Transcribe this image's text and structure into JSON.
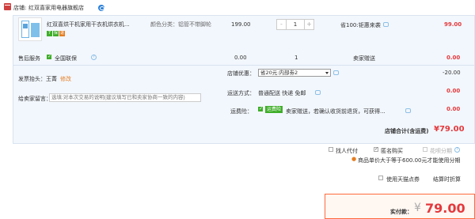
{
  "store": {
    "label": "店铺:",
    "name": "红双喜家用电器旗舰店"
  },
  "item": {
    "title": "红双喜烘干机家用干衣机烘衣机...",
    "spec": "颜色分类：铝管不带脚轮",
    "price": "199.00",
    "quantity": "1",
    "promo": "省100:钜惠来袭",
    "subtotal": "99.00",
    "badges": [
      "7",
      "保",
      "退"
    ],
    "badge_colors": [
      "#3fae29",
      "#3fae29",
      "#e67e22"
    ]
  },
  "service": {
    "label": "售后服务",
    "name": "全国联保",
    "price": "0.00",
    "quantity": "1",
    "freight_label": "卖家赠送",
    "subtotal": "0.00"
  },
  "invoice": {
    "label": "发票抬头：",
    "name": "王菁",
    "edit": "修改"
  },
  "store_coupon": {
    "label": "店铺优惠：",
    "selected": "省20元:内部劵2",
    "amount": "-20.00"
  },
  "message": {
    "label": "给卖家留言：",
    "placeholder": "选填:对本次交易的说明(建议填写已和卖家协商一致的内容)"
  },
  "delivery": {
    "label": "运送方式：",
    "value": "普通配送 快递 免邮",
    "amount": "0.00"
  },
  "insurance": {
    "label": "运费险：",
    "tag": "运费险",
    "text": "卖家赠送，若确认收货前退货，可获得...",
    "amount": "0.00"
  },
  "store_total": {
    "label": "店铺合计(含运费)",
    "amount": "¥79.00"
  },
  "options": {
    "proxy_pay": "找人代付",
    "anonymous": "匿名购买",
    "huabei": "花呗分期",
    "huabei_note": "商品单价大于等于600.00元才能使用分期",
    "tmall_points": "使用天猫点券",
    "settle_time": "结算时折算"
  },
  "payment": {
    "label": "实付款：",
    "currency": "¥",
    "amount": "79.00"
  },
  "colors": {
    "accent_red": "#e4393c",
    "box_bg": "#f2f7fd",
    "box_border": "#d9e3f0",
    "green": "#3fae29",
    "link_blue": "#2a7fd8"
  }
}
